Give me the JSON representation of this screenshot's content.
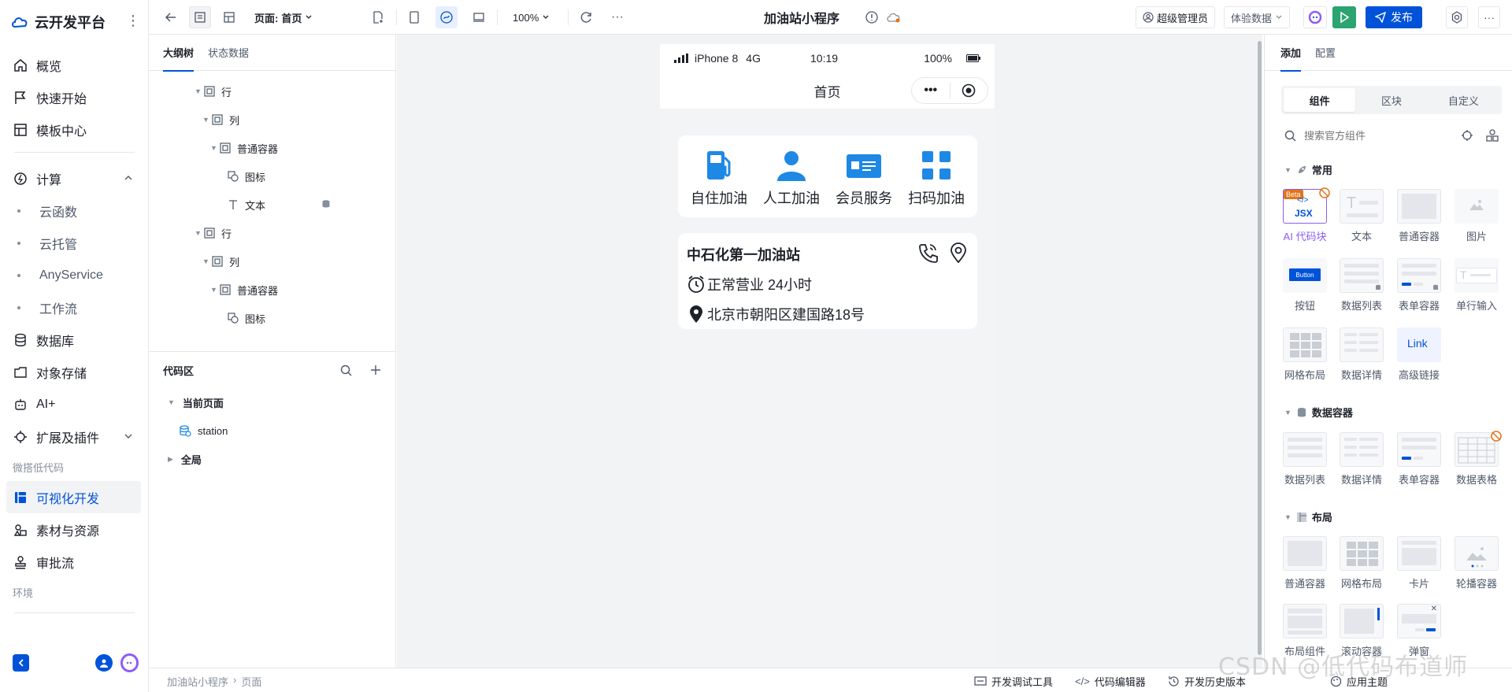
{
  "brand": {
    "name": "云开发平台"
  },
  "sidebar": {
    "items": [
      {
        "label": "概览",
        "icon": "home-icon"
      },
      {
        "label": "快速开始",
        "icon": "flag-icon"
      },
      {
        "label": "模板中心",
        "icon": "template-icon"
      }
    ],
    "compute": {
      "label": "计算",
      "icon": "compute-icon"
    },
    "compute_sub": [
      "云函数",
      "云托管",
      "AnyService",
      "工作流"
    ],
    "items2": [
      {
        "label": "数据库",
        "icon": "database-icon"
      },
      {
        "label": "对象存储",
        "icon": "storage-icon"
      },
      {
        "label": "AI+",
        "icon": "robot-icon"
      },
      {
        "label": "扩展及插件",
        "icon": "plugin-icon"
      }
    ],
    "section_lowcode": "微搭低代码",
    "lowcode_items": [
      {
        "label": "可视化开发",
        "icon": "layout-icon",
        "active": true
      },
      {
        "label": "素材与资源",
        "icon": "assets-icon"
      },
      {
        "label": "审批流",
        "icon": "approval-icon"
      }
    ],
    "section_env": "环境"
  },
  "toolbar": {
    "page_prefix": "页面:",
    "page_name": "首页",
    "zoom": "100%",
    "app_title": "加油站小程序",
    "user": "超级管理员",
    "data_mode": "体验数据",
    "publish": "发布"
  },
  "outline": {
    "tabs": [
      "大纲树",
      "状态数据"
    ],
    "rows": [
      {
        "label": "行",
        "indent": 0,
        "type": "container"
      },
      {
        "label": "列",
        "indent": 1,
        "type": "container"
      },
      {
        "label": "普通容器",
        "indent": 2,
        "type": "container"
      },
      {
        "label": "图标",
        "indent": 3,
        "type": "icon"
      },
      {
        "label": "文本",
        "indent": 3,
        "type": "text"
      },
      {
        "label": "行",
        "indent": 0,
        "type": "container"
      },
      {
        "label": "列",
        "indent": 1,
        "type": "container"
      },
      {
        "label": "普通容器",
        "indent": 2,
        "type": "container"
      },
      {
        "label": "图标",
        "indent": 3,
        "type": "icon"
      }
    ]
  },
  "code": {
    "title": "代码区",
    "current_page": "当前页面",
    "query": "station",
    "global": "全局"
  },
  "phone": {
    "device": "iPhone 8",
    "network": "4G",
    "time": "10:19",
    "battery": "100%",
    "nav_title": "首页",
    "grid": [
      {
        "label": "自住加油",
        "icon": "fuel-pump-icon"
      },
      {
        "label": "人工加油",
        "icon": "person-icon"
      },
      {
        "label": "会员服务",
        "icon": "member-card-icon"
      },
      {
        "label": "扫码加油",
        "icon": "grid-apps-icon"
      }
    ],
    "station": {
      "name": "中石化第一加油站",
      "hours": "正常营业 24小时",
      "address": "北京市朝阳区建国路18号"
    }
  },
  "right_panel": {
    "tabs": [
      "添加",
      "配置"
    ],
    "segments": [
      "组件",
      "区块",
      "自定义"
    ],
    "search_placeholder": "搜索官方组件",
    "groups": [
      {
        "title": "常用",
        "items": [
          "AI 代码块",
          "文本",
          "普通容器",
          "图片",
          "按钮",
          "数据列表",
          "表单容器",
          "单行输入",
          "网格布局",
          "数据详情",
          "高级链接"
        ]
      },
      {
        "title": "数据容器",
        "items": [
          "数据列表",
          "数据详情",
          "表单容器",
          "数据表格"
        ]
      },
      {
        "title": "布局",
        "items": [
          "普通容器",
          "网格布局",
          "卡片",
          "轮播容器",
          "布局组件",
          "滚动容器",
          "弹窗"
        ]
      }
    ],
    "beta_badge": "Beta",
    "jsx_label": "JSX",
    "button_label": "Button",
    "link_label": "Link"
  },
  "bottombar": {
    "crumbs": [
      "加油站小程序",
      "页面"
    ],
    "debug": "开发调试工具",
    "editor": "代码编辑器",
    "history": "开发历史版本",
    "theme": "应用主题"
  },
  "watermark": "CSDN @低代码布道师",
  "colors": {
    "primary": "#0052d9",
    "accent_blue": "#1e88e5",
    "ai_purple": "#8c5cf7",
    "run_green": "#2ba471"
  }
}
